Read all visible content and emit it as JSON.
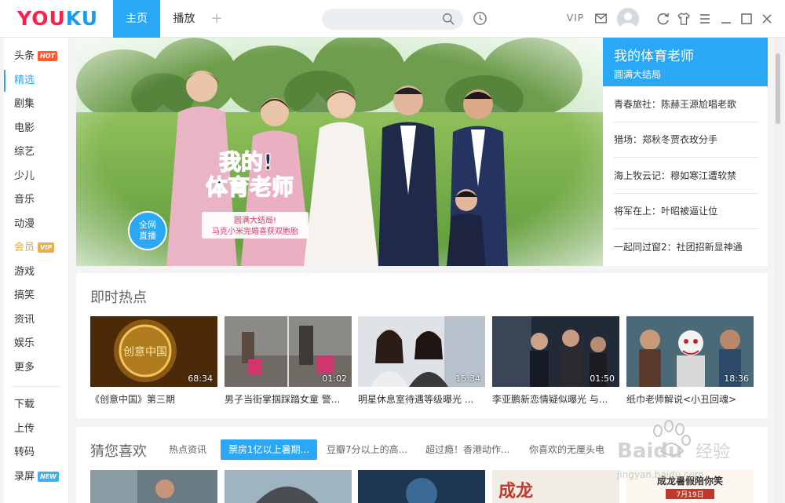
{
  "header": {
    "logo": {
      "left": "YOU",
      "right": "KU"
    },
    "tabs": [
      {
        "label": "主页"
      },
      {
        "label": "播放"
      }
    ],
    "add_tab": "+",
    "search": {
      "placeholder": ""
    },
    "vip": "VIP",
    "colors": {
      "accent": "#2aa7f5",
      "logo_red": "#ff1f4b",
      "logo_blue": "#1e9bf0"
    }
  },
  "sidebar": {
    "items": [
      {
        "label": "头条",
        "badge": "HOT"
      },
      {
        "label": "精选"
      },
      {
        "label": "剧集"
      },
      {
        "label": "电影"
      },
      {
        "label": "综艺"
      },
      {
        "label": "少儿"
      },
      {
        "label": "音乐"
      },
      {
        "label": "动漫"
      },
      {
        "label": "会员",
        "badge": "VIP"
      },
      {
        "label": "游戏"
      },
      {
        "label": "搞笑"
      },
      {
        "label": "资讯"
      },
      {
        "label": "娱乐"
      },
      {
        "label": "更多"
      }
    ],
    "tools": [
      {
        "label": "下载"
      },
      {
        "label": "上传"
      },
      {
        "label": "转码"
      },
      {
        "label": "录屏",
        "badge": "NEW"
      }
    ]
  },
  "banner": {
    "title_line1": "我的!",
    "title_line2": "体育老师",
    "caption_line1": "圆满大结局!",
    "caption_line2": "马克小米完婚喜获双胞胎",
    "live_line1": "全网",
    "live_line2": "直播",
    "panel": {
      "title": "我的体育老师",
      "subtitle": "圆满大结局",
      "items": [
        "青春旅社：陈赫王源尬唱老歌",
        "猎场：郑秋冬贾衣玫分手",
        "海上牧云记：穆如寒江遭软禁",
        "将军在上：叶昭被逼让位",
        "一起同过窗2：社团招新显神通"
      ]
    }
  },
  "hot": {
    "title": "即时热点",
    "videos": [
      {
        "caption": "《创意中国》第三期",
        "duration": "68:34",
        "overlay": "创意中国"
      },
      {
        "caption": "男子当街掌掴踩踏女童 警...",
        "duration": "01:02"
      },
      {
        "caption": "明星休息室待遇等级曝光 ...",
        "duration": "15:34"
      },
      {
        "caption": "李亚鹏新恋情疑似曝光 与...",
        "duration": "01:50"
      },
      {
        "caption": "纸巾老师解说<小丑回魂>",
        "duration": "18:36"
      }
    ]
  },
  "recommend": {
    "title": "猜您喜欢",
    "filters": [
      "热点资讯",
      "票房1亿以上暑期...",
      "豆瓣7分以上的高...",
      "超过瘾！香港动作...",
      "你喜欢的无厘头电"
    ],
    "active_filter_index": 1,
    "thumb_text": "成龙暑假陪你笑",
    "thumb_date": "7月19日"
  },
  "watermark": {
    "brand": "Baidu",
    "cn": "经验",
    "url": "jingyan.baidu.com"
  }
}
